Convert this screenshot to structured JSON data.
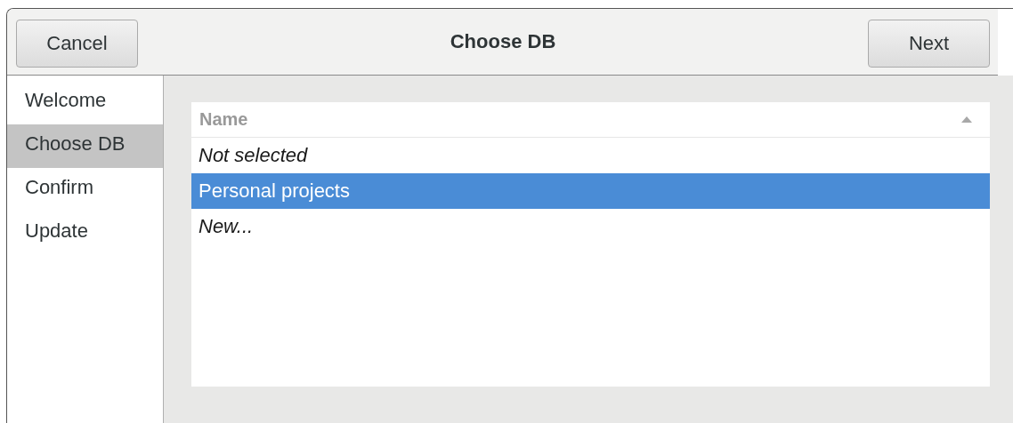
{
  "header": {
    "cancel": "Cancel",
    "title": "Choose DB",
    "next": "Next"
  },
  "sidebar": {
    "items": [
      {
        "label": "Welcome",
        "selected": false
      },
      {
        "label": "Choose DB",
        "selected": true
      },
      {
        "label": "Confirm",
        "selected": false
      },
      {
        "label": "Update",
        "selected": false
      }
    ]
  },
  "list": {
    "column": "Name",
    "rows": [
      {
        "label": "Not selected",
        "kind": "special",
        "selected": false
      },
      {
        "label": "Personal projects",
        "kind": "entry",
        "selected": true
      },
      {
        "label": "New...",
        "kind": "special",
        "selected": false
      }
    ]
  }
}
